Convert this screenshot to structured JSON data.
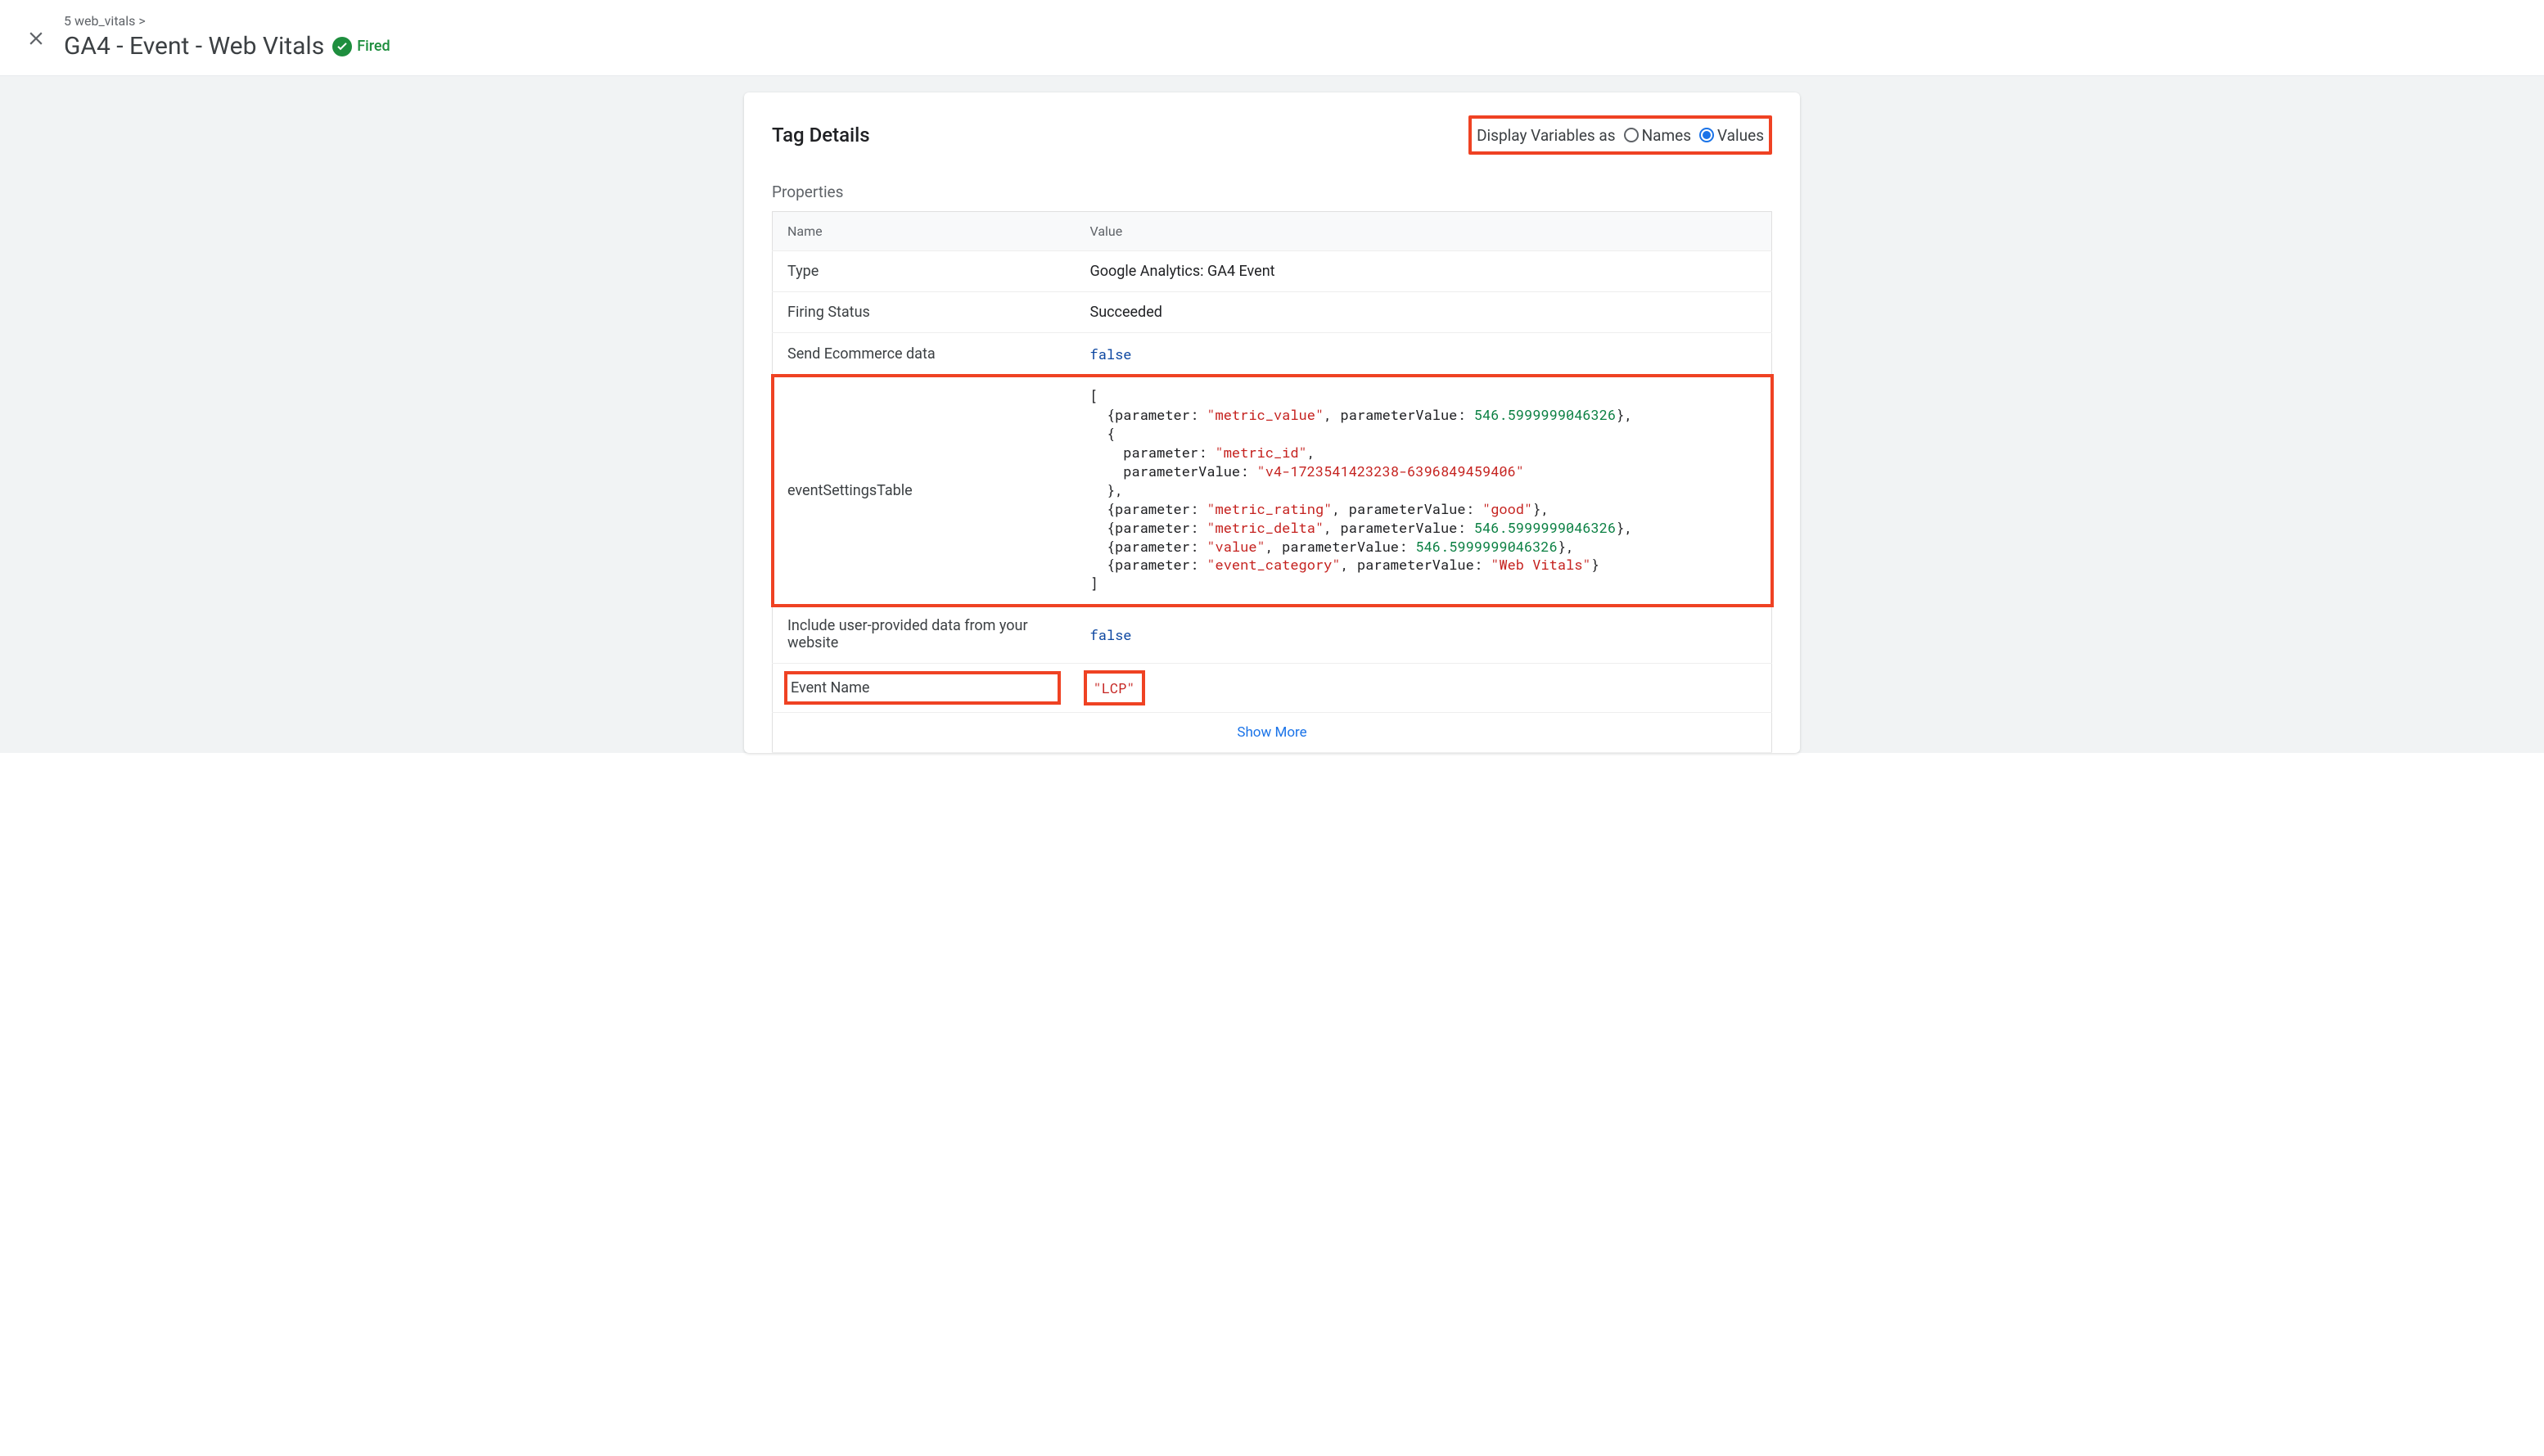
{
  "breadcrumb": "5 web_vitals >",
  "title": "GA4 - Event - Web Vitals",
  "fired_label": "Fired",
  "panel_title": "Tag Details",
  "display_variables_label": "Display Variables as",
  "radio_names": "Names",
  "radio_values": "Values",
  "section_properties": "Properties",
  "col_name": "Name",
  "col_value": "Value",
  "rows": {
    "type": {
      "name": "Type",
      "value": "Google Analytics: GA4 Event"
    },
    "firing_status": {
      "name": "Firing Status",
      "value": "Succeeded"
    },
    "send_ecommerce": {
      "name": "Send Ecommerce data",
      "value": "false"
    },
    "event_settings_table": {
      "name": "eventSettingsTable"
    },
    "include_user_data": {
      "name": "Include user-provided data from your website",
      "value": "false"
    },
    "event_name": {
      "name": "Event Name",
      "value": "\"LCP\""
    }
  },
  "event_settings": {
    "open": "[",
    "line1_a": "  {parameter: ",
    "line1_b": "\"metric_value\"",
    "line1_c": ", parameterValue: ",
    "line1_d": "546.5999999046326",
    "line1_e": "},",
    "line2": "  {",
    "line3_a": "    parameter: ",
    "line3_b": "\"metric_id\"",
    "line3_c": ",",
    "line4_a": "    parameterValue: ",
    "line4_b": "\"v4-1723541423238-6396849459406\"",
    "line5": "  },",
    "line6_a": "  {parameter: ",
    "line6_b": "\"metric_rating\"",
    "line6_c": ", parameterValue: ",
    "line6_d": "\"good\"",
    "line6_e": "},",
    "line7_a": "  {parameter: ",
    "line7_b": "\"metric_delta\"",
    "line7_c": ", parameterValue: ",
    "line7_d": "546.5999999046326",
    "line7_e": "},",
    "line8_a": "  {parameter: ",
    "line8_b": "\"value\"",
    "line8_c": ", parameterValue: ",
    "line8_d": "546.5999999046326",
    "line8_e": "},",
    "line9_a": "  {parameter: ",
    "line9_b": "\"event_category\"",
    "line9_c": ", parameterValue: ",
    "line9_d": "\"Web Vitals\"",
    "line9_e": "}",
    "close": "]"
  },
  "show_more": "Show More"
}
